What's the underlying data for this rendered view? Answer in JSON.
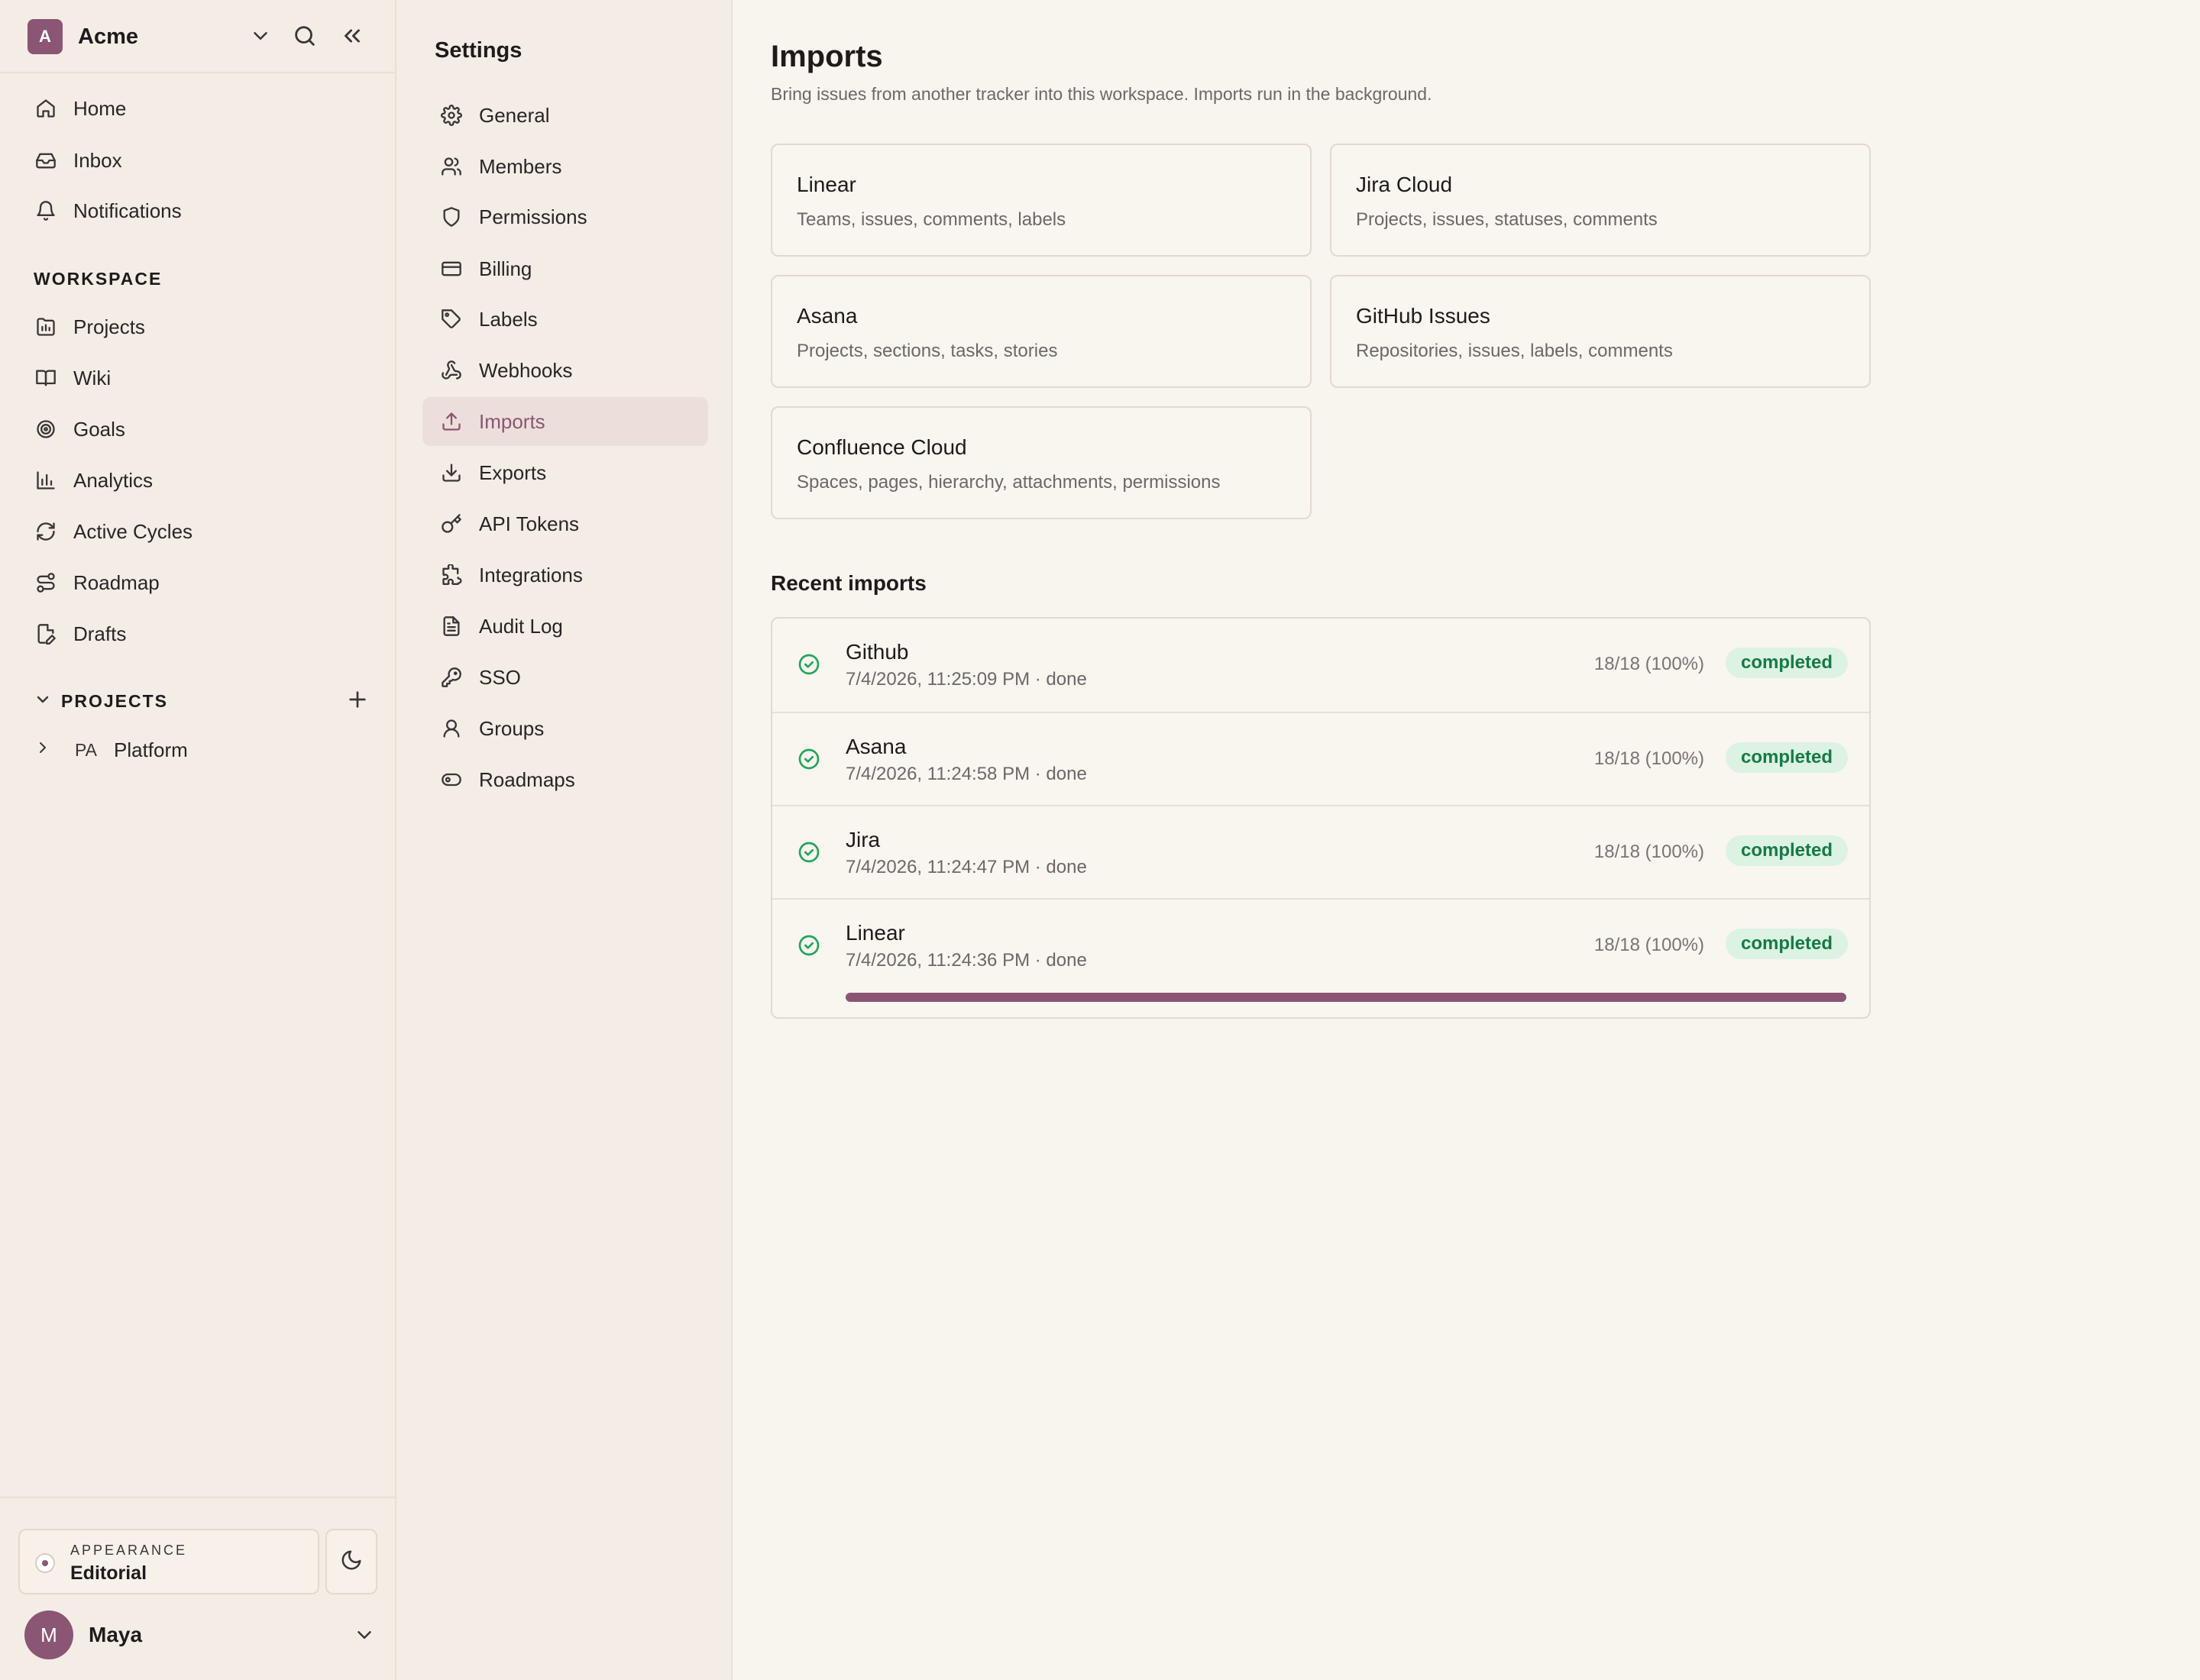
{
  "workspace": {
    "avatar_letter": "A",
    "name": "Acme"
  },
  "nav": [
    {
      "label": "Home",
      "icon": "home-icon"
    },
    {
      "label": "Inbox",
      "icon": "inbox-icon"
    },
    {
      "label": "Notifications",
      "icon": "bell-icon"
    }
  ],
  "workspace_section": {
    "label": "WORKSPACE",
    "items": [
      {
        "label": "Projects",
        "icon": "projects-icon"
      },
      {
        "label": "Wiki",
        "icon": "book-icon"
      },
      {
        "label": "Goals",
        "icon": "target-icon"
      },
      {
        "label": "Analytics",
        "icon": "bar-chart-icon"
      },
      {
        "label": "Active Cycles",
        "icon": "refresh-icon"
      },
      {
        "label": "Roadmap",
        "icon": "route-icon"
      },
      {
        "label": "Drafts",
        "icon": "draft-icon"
      }
    ]
  },
  "projects": {
    "label": "PROJECTS",
    "items": [
      {
        "abbr": "PA",
        "name": "Platform"
      }
    ]
  },
  "appearance": {
    "caption": "APPEARANCE",
    "value": "Editorial"
  },
  "user": {
    "avatar_letter": "M",
    "name": "Maya"
  },
  "settings": {
    "title": "Settings",
    "items": [
      {
        "label": "General",
        "icon": "gear-icon"
      },
      {
        "label": "Members",
        "icon": "users-icon"
      },
      {
        "label": "Permissions",
        "icon": "shield-icon"
      },
      {
        "label": "Billing",
        "icon": "credit-card-icon"
      },
      {
        "label": "Labels",
        "icon": "tag-icon"
      },
      {
        "label": "Webhooks",
        "icon": "webhook-icon"
      },
      {
        "label": "Imports",
        "icon": "upload-icon",
        "active": true
      },
      {
        "label": "Exports",
        "icon": "download-icon"
      },
      {
        "label": "API Tokens",
        "icon": "key-icon"
      },
      {
        "label": "Integrations",
        "icon": "puzzle-icon"
      },
      {
        "label": "Audit Log",
        "icon": "file-text-icon"
      },
      {
        "label": "SSO",
        "icon": "key-round-icon"
      },
      {
        "label": "Groups",
        "icon": "group-icon"
      },
      {
        "label": "Roadmaps",
        "icon": "toggle-icon"
      }
    ]
  },
  "page": {
    "title": "Imports",
    "subtitle": "Bring issues from another tracker into this workspace. Imports run in the background."
  },
  "sources": [
    {
      "name": "Linear",
      "description": "Teams, issues, comments, labels"
    },
    {
      "name": "Jira Cloud",
      "description": "Projects, issues, statuses, comments"
    },
    {
      "name": "Asana",
      "description": "Projects, sections, tasks, stories"
    },
    {
      "name": "GitHub Issues",
      "description": "Repositories, issues, labels, comments"
    },
    {
      "name": "Confluence Cloud",
      "description": "Spaces, pages, hierarchy, attachments, permissions"
    }
  ],
  "recent": {
    "title": "Recent imports",
    "items": [
      {
        "name": "Github",
        "meta": "7/4/2026, 11:25:09 PM · done",
        "count": "18/18 (100%)",
        "status": "completed"
      },
      {
        "name": "Asana",
        "meta": "7/4/2026, 11:24:58 PM · done",
        "count": "18/18 (100%)",
        "status": "completed"
      },
      {
        "name": "Jira",
        "meta": "7/4/2026, 11:24:47 PM · done",
        "count": "18/18 (100%)",
        "status": "completed"
      },
      {
        "name": "Linear",
        "meta": "7/4/2026, 11:24:36 PM · done",
        "count": "18/18 (100%)",
        "status": "completed",
        "progress": 1.0
      }
    ]
  },
  "colors": {
    "accent": "#8a5674",
    "success": "#22a55b",
    "badge_bg": "#dcf2e3",
    "badge_text": "#157a45"
  }
}
